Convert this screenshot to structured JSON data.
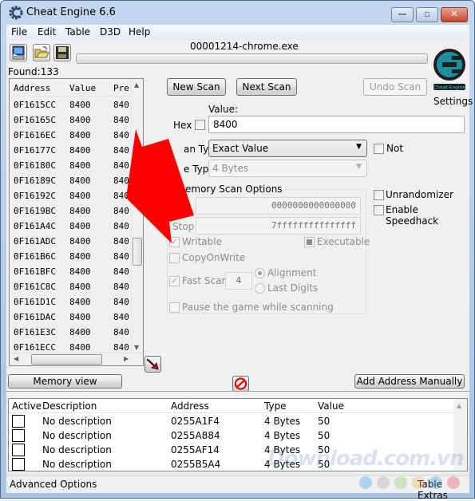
{
  "window": {
    "title": "Cheat Engine 6.6",
    "controls": {
      "minimize": "—",
      "maximize": "▫",
      "close": "✕"
    }
  },
  "menu": [
    "File",
    "Edit",
    "Table",
    "D3D",
    "Help"
  ],
  "toolbar": {
    "icons": [
      "open-process-icon",
      "open-file-icon",
      "save-icon"
    ],
    "process_name": "00001214-chrome.exe",
    "progress_percent": 0
  },
  "found": "Found:133",
  "results": {
    "columns": [
      "Address",
      "Value",
      "Pre"
    ],
    "rows": [
      {
        "address": "0F1615CC",
        "value": "8400",
        "previous": "840"
      },
      {
        "address": "0F16165C",
        "value": "8400",
        "previous": "840"
      },
      {
        "address": "0F1616EC",
        "value": "8400",
        "previous": "840"
      },
      {
        "address": "0F16177C",
        "value": "8400",
        "previous": "840"
      },
      {
        "address": "0F16180C",
        "value": "8400",
        "previous": "840"
      },
      {
        "address": "0F16189C",
        "value": "8400",
        "previous": "840"
      },
      {
        "address": "0F16192C",
        "value": "8400",
        "previous": "840"
      },
      {
        "address": "0F1619BC",
        "value": "8400",
        "previous": "840"
      },
      {
        "address": "0F161A4C",
        "value": "8400",
        "previous": "840"
      },
      {
        "address": "0F161ADC",
        "value": "8400",
        "previous": "840"
      },
      {
        "address": "0F161B6C",
        "value": "8400",
        "previous": "840"
      },
      {
        "address": "0F161BFC",
        "value": "8400",
        "previous": "840"
      },
      {
        "address": "0F161C8C",
        "value": "8400",
        "previous": "840"
      },
      {
        "address": "0F161D1C",
        "value": "8400",
        "previous": "840"
      },
      {
        "address": "0F161DAC",
        "value": "8400",
        "previous": "840"
      },
      {
        "address": "0F161E3C",
        "value": "8400",
        "previous": "840"
      },
      {
        "address": "0F161ECC",
        "value": "8400",
        "previous": "840"
      }
    ]
  },
  "scan": {
    "new_scan": "New Scan",
    "next_scan": "Next Scan",
    "undo_scan": "Undo Scan",
    "settings": "Settings",
    "logo_caption": "Cheat Engine",
    "value_label": "Value:",
    "hex_label": "Hex",
    "value": "8400",
    "scan_type_label": "an Type",
    "scan_type": "Exact Value",
    "not_label": "Not",
    "value_type_label": "e Type",
    "value_type": "4 Bytes",
    "memory_options_label": "emory Scan Options",
    "start": "0000000000000000",
    "stop_label": "Stop",
    "stop": "7fffffffffffffff",
    "writable": "Writable",
    "executable": "Executable",
    "copy_on_write": "CopyOnWrite",
    "fast_scan": "Fast Scan",
    "fast_scan_value": "4",
    "alignment": "Alignment",
    "last_digits": "Last Digits",
    "pause_game": "Pause the game while scanning",
    "unrandomizer": "Unrandomizer",
    "speedhack": "Enable Speedhack"
  },
  "bottom_buttons": {
    "memory_view": "Memory view",
    "add_address": "Add Address Manually"
  },
  "address_table": {
    "columns": [
      "Active",
      "Description",
      "Address",
      "Type",
      "Value"
    ],
    "rows": [
      {
        "description": "No description",
        "address": "0255A1F4",
        "type": "4 Bytes",
        "value": "50"
      },
      {
        "description": "No description",
        "address": "0255A884",
        "type": "4 Bytes",
        "value": "50"
      },
      {
        "description": "No description",
        "address": "0255AF14",
        "type": "4 Bytes",
        "value": "50"
      },
      {
        "description": "No description",
        "address": "0255B5A4",
        "type": "4 Bytes",
        "value": "50"
      }
    ]
  },
  "status": {
    "advanced_options": "Advanced Options",
    "table_extras": "Table Extras"
  },
  "watermark": "Download.com.vn",
  "colors": {
    "annotation_arrow": "#ff0000",
    "logo": "#1e8fa0"
  }
}
